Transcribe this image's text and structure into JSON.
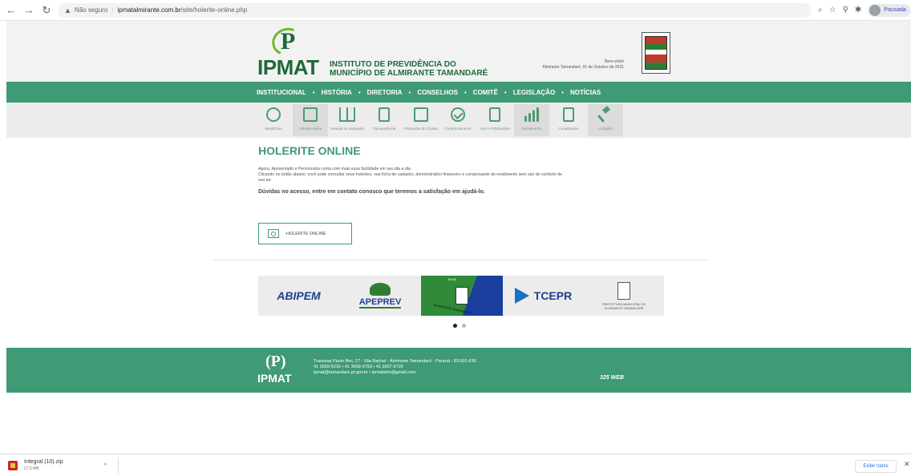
{
  "browser": {
    "security_label": "Não seguro",
    "url_domain": "ipmatalmirante.com.br",
    "url_path": "/site/holerite-online.php",
    "profile_label": "Pausada"
  },
  "header": {
    "logo_word": "IPMAT",
    "logo_line1": "INSTITUTO DE PREVIDÊNCIA DO",
    "logo_line2": "MUNICÍPIO DE ALMIRANTE TAMANDARÉ",
    "welcome_line1": "Bem-vindo",
    "welcome_line2": "Almirante Tamandaré, 01 de Outubro de 2021"
  },
  "mainnav": [
    "INSTITUCIONAL",
    "HISTÓRIA",
    "DIRETORIA",
    "CONSELHOS",
    "COMITÊ",
    "LEGISLAÇÃO",
    "NOTÍCIAS"
  ],
  "iconbar": [
    {
      "label": "Benefícios",
      "icon": "hands-icon"
    },
    {
      "label": "Holerite online",
      "icon": "monitor-icon"
    },
    {
      "label": "Manual do segurado",
      "icon": "book-icon"
    },
    {
      "label": "Transparência",
      "icon": "document-search-icon"
    },
    {
      "label": "Prestação de Contas",
      "icon": "printer-icon"
    },
    {
      "label": "Credenciamento",
      "icon": "check-circle-icon"
    },
    {
      "label": "Atos e Publicações",
      "icon": "publication-icon"
    },
    {
      "label": "Investimento",
      "icon": "bar-chart-icon"
    },
    {
      "label": "Contribuição",
      "icon": "money-doc-icon"
    },
    {
      "label": "Licitação",
      "icon": "gavel-icon"
    }
  ],
  "content": {
    "title": "HOLERITE ONLINE",
    "para_line1": "Agora, Aposentado e Pensionista conta com mais essa facilidade em seu dia a dia.",
    "para_line2": "Clicando no botão abaixo, você pode consultar seus holerites, sua ficha de cadastro, demonstrativo financeiro e comprovante de rendimento sem sair do conforto de",
    "para_line3": "seu lar.",
    "notice": "Dúvidas no acesso, entre em contato conosco que teremos a satisfação em ajudá-lo.",
    "button_label": "HOLERITE ONLINE"
  },
  "partners": {
    "abipem": "ABIPEM",
    "apeprev": "APEPREV",
    "munic_top": "MUNI",
    "munic_label": "ALMIRANTE TAMANDARÉ",
    "tce": "TCEPR",
    "pref_line1": "PREFEITURA MUNICIPAL DE",
    "pref_line2": "ALMIRANTE TAMANDARÉ"
  },
  "footer": {
    "logo_word": "IPMAT",
    "address": "Travessa Paulo Bini, 27 - Vila Rachel - Almirante Tamandaré - Paraná - 83.501-630",
    "phones": "41 3699-5216 • 41 3699-3793 • 41 3657-6726",
    "emails": "ipmat@tamandare.pr.gov.br • ipmatadm@gmail.com",
    "credit_brand": "325 WEB"
  },
  "downloads": {
    "file_name": "Integral (10).zip",
    "file_size": "27,5 MB",
    "show_all": "Exibir todos"
  }
}
